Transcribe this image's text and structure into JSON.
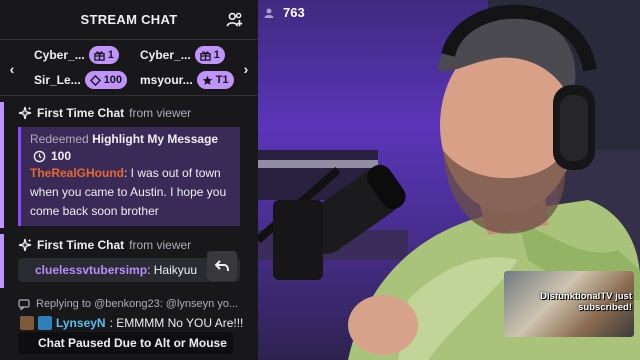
{
  "chat": {
    "header_title": "STREAM CHAT",
    "gifters": [
      {
        "name": "Cyber_...",
        "badge_icon": "gift-icon",
        "count": "1"
      },
      {
        "name": "Cyber_...",
        "badge_icon": "gift-icon",
        "count": "1"
      },
      {
        "name": "Sir_Le...",
        "badge_icon": "channel-points-icon",
        "count": "100"
      },
      {
        "name": "msyour...",
        "badge_icon": "star-icon",
        "count": "T1"
      }
    ],
    "first_time_1": {
      "title": "First Time Chat",
      "subtitle": "from viewer",
      "redeemed_prefix": "Redeemed",
      "reward_name": "Highlight My Message",
      "points": "100",
      "username": "TheRealGHound",
      "message": ": I was out of town when you came to Austin. I hope you come back soon brother"
    },
    "first_time_2": {
      "title": "First Time Chat",
      "subtitle": "from viewer",
      "username": "cluelessvtubersimp",
      "message": ": Haikyuu"
    },
    "reply": {
      "text": "Replying to @benkong23: @lynseyn yo..."
    },
    "lynsey": {
      "username": "LynseyN",
      "message": ": EMMMM No YOU Are!!!"
    },
    "paused_text": "Chat Paused Due to Alt or Mouse"
  },
  "video": {
    "viewer_count": "763",
    "sub_alert_text": "DisfunktionalTV just subscribed!"
  },
  "colors": {
    "accent": "#bf94ff",
    "panel": "#18181b",
    "highlight_bg": "#3a2a57"
  }
}
